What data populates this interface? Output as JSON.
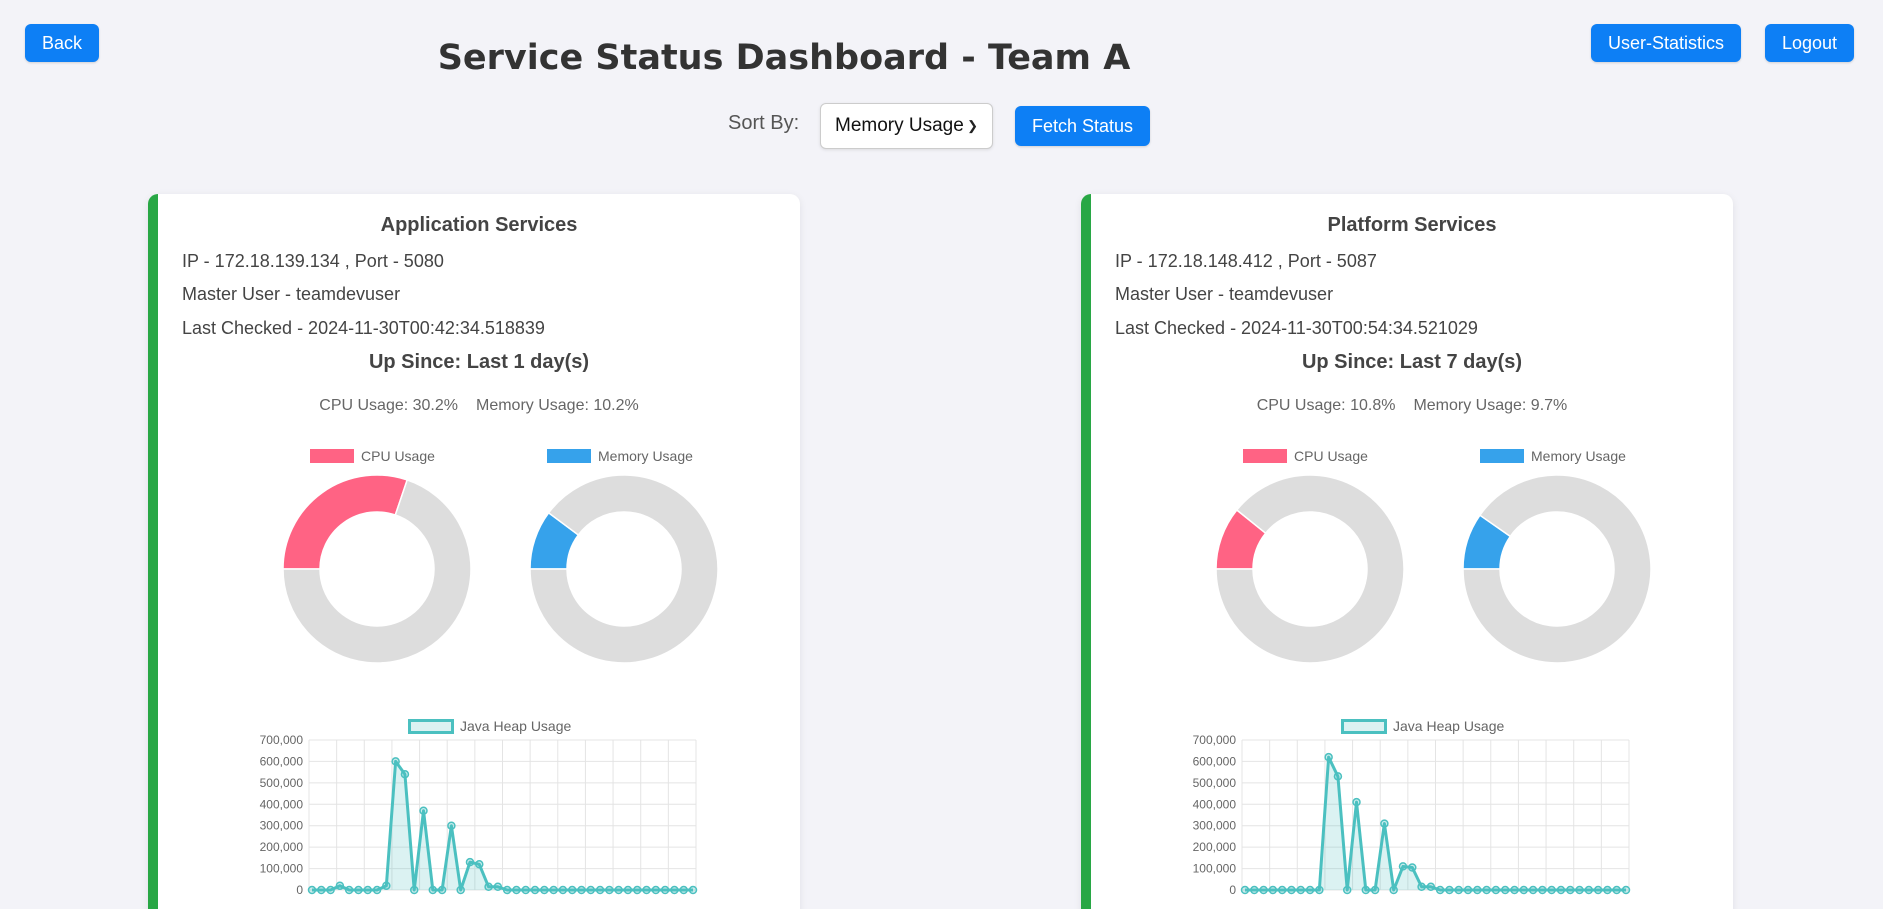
{
  "header": {
    "title": "Service Status Dashboard - Team A",
    "back_label": "Back",
    "stats_label": "User-Statistics",
    "logout_label": "Logout"
  },
  "controls": {
    "sort_label": "Sort By:",
    "sort_value": "Memory Usage",
    "fetch_label": "Fetch Status"
  },
  "colors": {
    "primary": "#0d7ff5",
    "status_ok": "#28a745",
    "cpu": "#ff6384",
    "memory": "#36a2eb",
    "heap": "#4bc0c0",
    "ring_bg": "#dddddd"
  },
  "services": [
    {
      "name": "Application Services",
      "ip_line": "IP - 172.18.139.134 , Port - 5080",
      "master_line": "Master User - teamdevuser",
      "checked_line": "Last Checked - 2024-11-30T00:42:34.518839",
      "up_since": "Up Since: Last 1 day(s)",
      "cpu_text": "CPU Usage: 30.2%",
      "mem_text": "Memory Usage: 10.2%",
      "cpu_legend": "CPU Usage",
      "mem_legend": "Memory Usage",
      "heap_legend": "Java Heap Usage",
      "chart_data": [
        {
          "type": "pie",
          "variant": "doughnut",
          "series": [
            {
              "name": "CPU Usage",
              "values": [
                30.2,
                69.8
              ]
            }
          ]
        },
        {
          "type": "pie",
          "variant": "doughnut",
          "series": [
            {
              "name": "Memory Usage",
              "values": [
                10.2,
                89.8
              ]
            }
          ]
        },
        {
          "type": "line",
          "y_ticks": [
            "700,000",
            "600,000",
            "500,000",
            "400,000",
            "300,000",
            "200,000",
            "100,000",
            "0"
          ],
          "ylim": [
            0,
            700000
          ],
          "series": [
            {
              "name": "Java Heap Usage",
              "values": [
                0,
                0,
                0,
                20000,
                0,
                0,
                0,
                0,
                20000,
                600000,
                540000,
                0,
                370000,
                0,
                0,
                300000,
                0,
                130000,
                120000,
                15000,
                15000,
                0,
                0,
                0,
                0,
                0,
                0,
                0,
                0,
                0,
                0,
                0,
                0,
                0,
                0,
                0,
                0,
                0,
                0,
                0,
                0,
                0
              ]
            }
          ]
        }
      ]
    },
    {
      "name": "Platform Services",
      "ip_line": "IP - 172.18.148.412 , Port - 5087",
      "master_line": "Master User - teamdevuser",
      "checked_line": "Last Checked - 2024-11-30T00:54:34.521029",
      "up_since": "Up Since: Last 7 day(s)",
      "cpu_text": "CPU Usage: 10.8%",
      "mem_text": "Memory Usage: 9.7%",
      "cpu_legend": "CPU Usage",
      "mem_legend": "Memory Usage",
      "heap_legend": "Java Heap Usage",
      "chart_data": [
        {
          "type": "pie",
          "variant": "doughnut",
          "series": [
            {
              "name": "CPU Usage",
              "values": [
                10.8,
                89.2
              ]
            }
          ]
        },
        {
          "type": "pie",
          "variant": "doughnut",
          "series": [
            {
              "name": "Memory Usage",
              "values": [
                9.7,
                90.3
              ]
            }
          ]
        },
        {
          "type": "line",
          "y_ticks": [
            "700,000",
            "600,000",
            "500,000",
            "400,000",
            "300,000",
            "200,000",
            "100,000",
            "0"
          ],
          "ylim": [
            0,
            700000
          ],
          "series": [
            {
              "name": "Java Heap Usage",
              "values": [
                0,
                0,
                0,
                0,
                0,
                0,
                0,
                0,
                0,
                620000,
                530000,
                0,
                410000,
                0,
                0,
                310000,
                0,
                110000,
                105000,
                15000,
                15000,
                0,
                0,
                0,
                0,
                0,
                0,
                0,
                0,
                0,
                0,
                0,
                0,
                0,
                0,
                0,
                0,
                0,
                0,
                0,
                0,
                0
              ]
            }
          ]
        }
      ]
    }
  ]
}
